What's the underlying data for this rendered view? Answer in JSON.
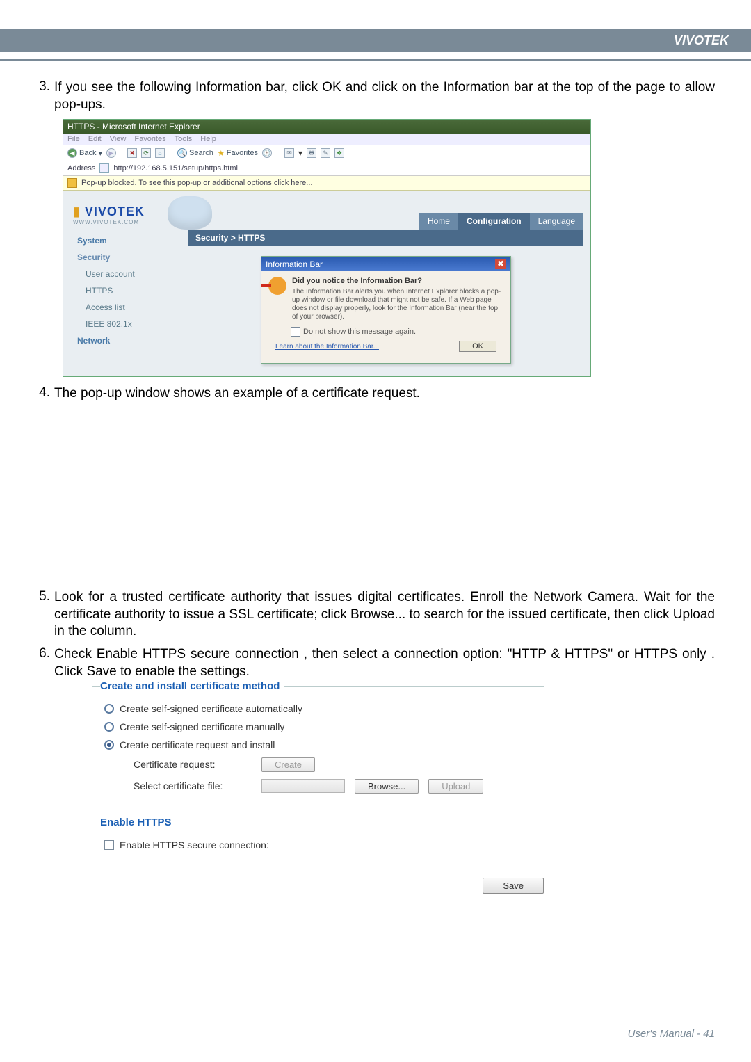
{
  "header": {
    "brand": "VIVOTEK"
  },
  "steps": {
    "s3": {
      "num": "3.",
      "text": "If you see the following Information bar, click OK and click on the Information bar at the top of the page to allow pop-ups."
    },
    "s4": {
      "num": "4.",
      "text": "The pop-up window shows an example of a certificate request."
    },
    "s5": {
      "num": "5.",
      "text": "Look for a trusted certificate authority that issues digital certificates. Enroll the Network Camera. Wait for the certificate authority to issue a SSL certificate; click Browse...  to search for the issued certificate, then click Upload  in the column."
    },
    "s6": {
      "num": "6.",
      "text": "Check Enable HTTPS secure connection   , then select a connection option: \"HTTP & HTTPS\" or HTTPS only .  Click Save to enable the settings."
    }
  },
  "ie": {
    "title": "HTTPS - Microsoft Internet Explorer",
    "menu": [
      "File",
      "Edit",
      "View",
      "Favorites",
      "Tools",
      "Help"
    ],
    "back": "Back",
    "search": "Search",
    "favorites": "Favorites",
    "addr_label": "Address",
    "addr_url": "http://192.168.5.151/setup/https.html",
    "infobar": "Pop-up blocked. To see this pop-up or additional options click here...",
    "logo": "VIVOTEK",
    "logo_sub": "WWW.VIVOTEK.COM",
    "tabs": {
      "home": "Home",
      "conf": "Configuration",
      "lang": "Language"
    },
    "breadcrumb": "Security  > HTTPS",
    "nav": {
      "system": "System",
      "security": "Security",
      "user": "User account",
      "https": "HTTPS",
      "access": "Access list",
      "ieee": "IEEE 802.1x",
      "network": "Network"
    },
    "dialog": {
      "title": "Information Bar",
      "q": "Did you notice the Information Bar?",
      "body": "The Information Bar alerts you when Internet Explorer blocks a pop-up window or file download that might not be safe. If a Web page does not display properly, look for the Information Bar (near the top of your browser).",
      "chk": "Do not show this message again.",
      "link": "Learn about the Information Bar...",
      "ok": "OK"
    }
  },
  "panel": {
    "fs1_legend": "Create and install certificate method",
    "r1": "Create self-signed certificate automatically",
    "r2": "Create self-signed certificate manually",
    "r3": "Create certificate request and install",
    "cert_req_lbl": "Certificate request:",
    "create_btn": "Create",
    "sel_file_lbl": "Select certificate file:",
    "browse_btn": "Browse...",
    "upload_btn": "Upload",
    "fs2_legend": "Enable HTTPS",
    "enable_lbl": "Enable HTTPS secure connection:",
    "save_btn": "Save"
  },
  "footer": {
    "text": "User's Manual - 41"
  }
}
